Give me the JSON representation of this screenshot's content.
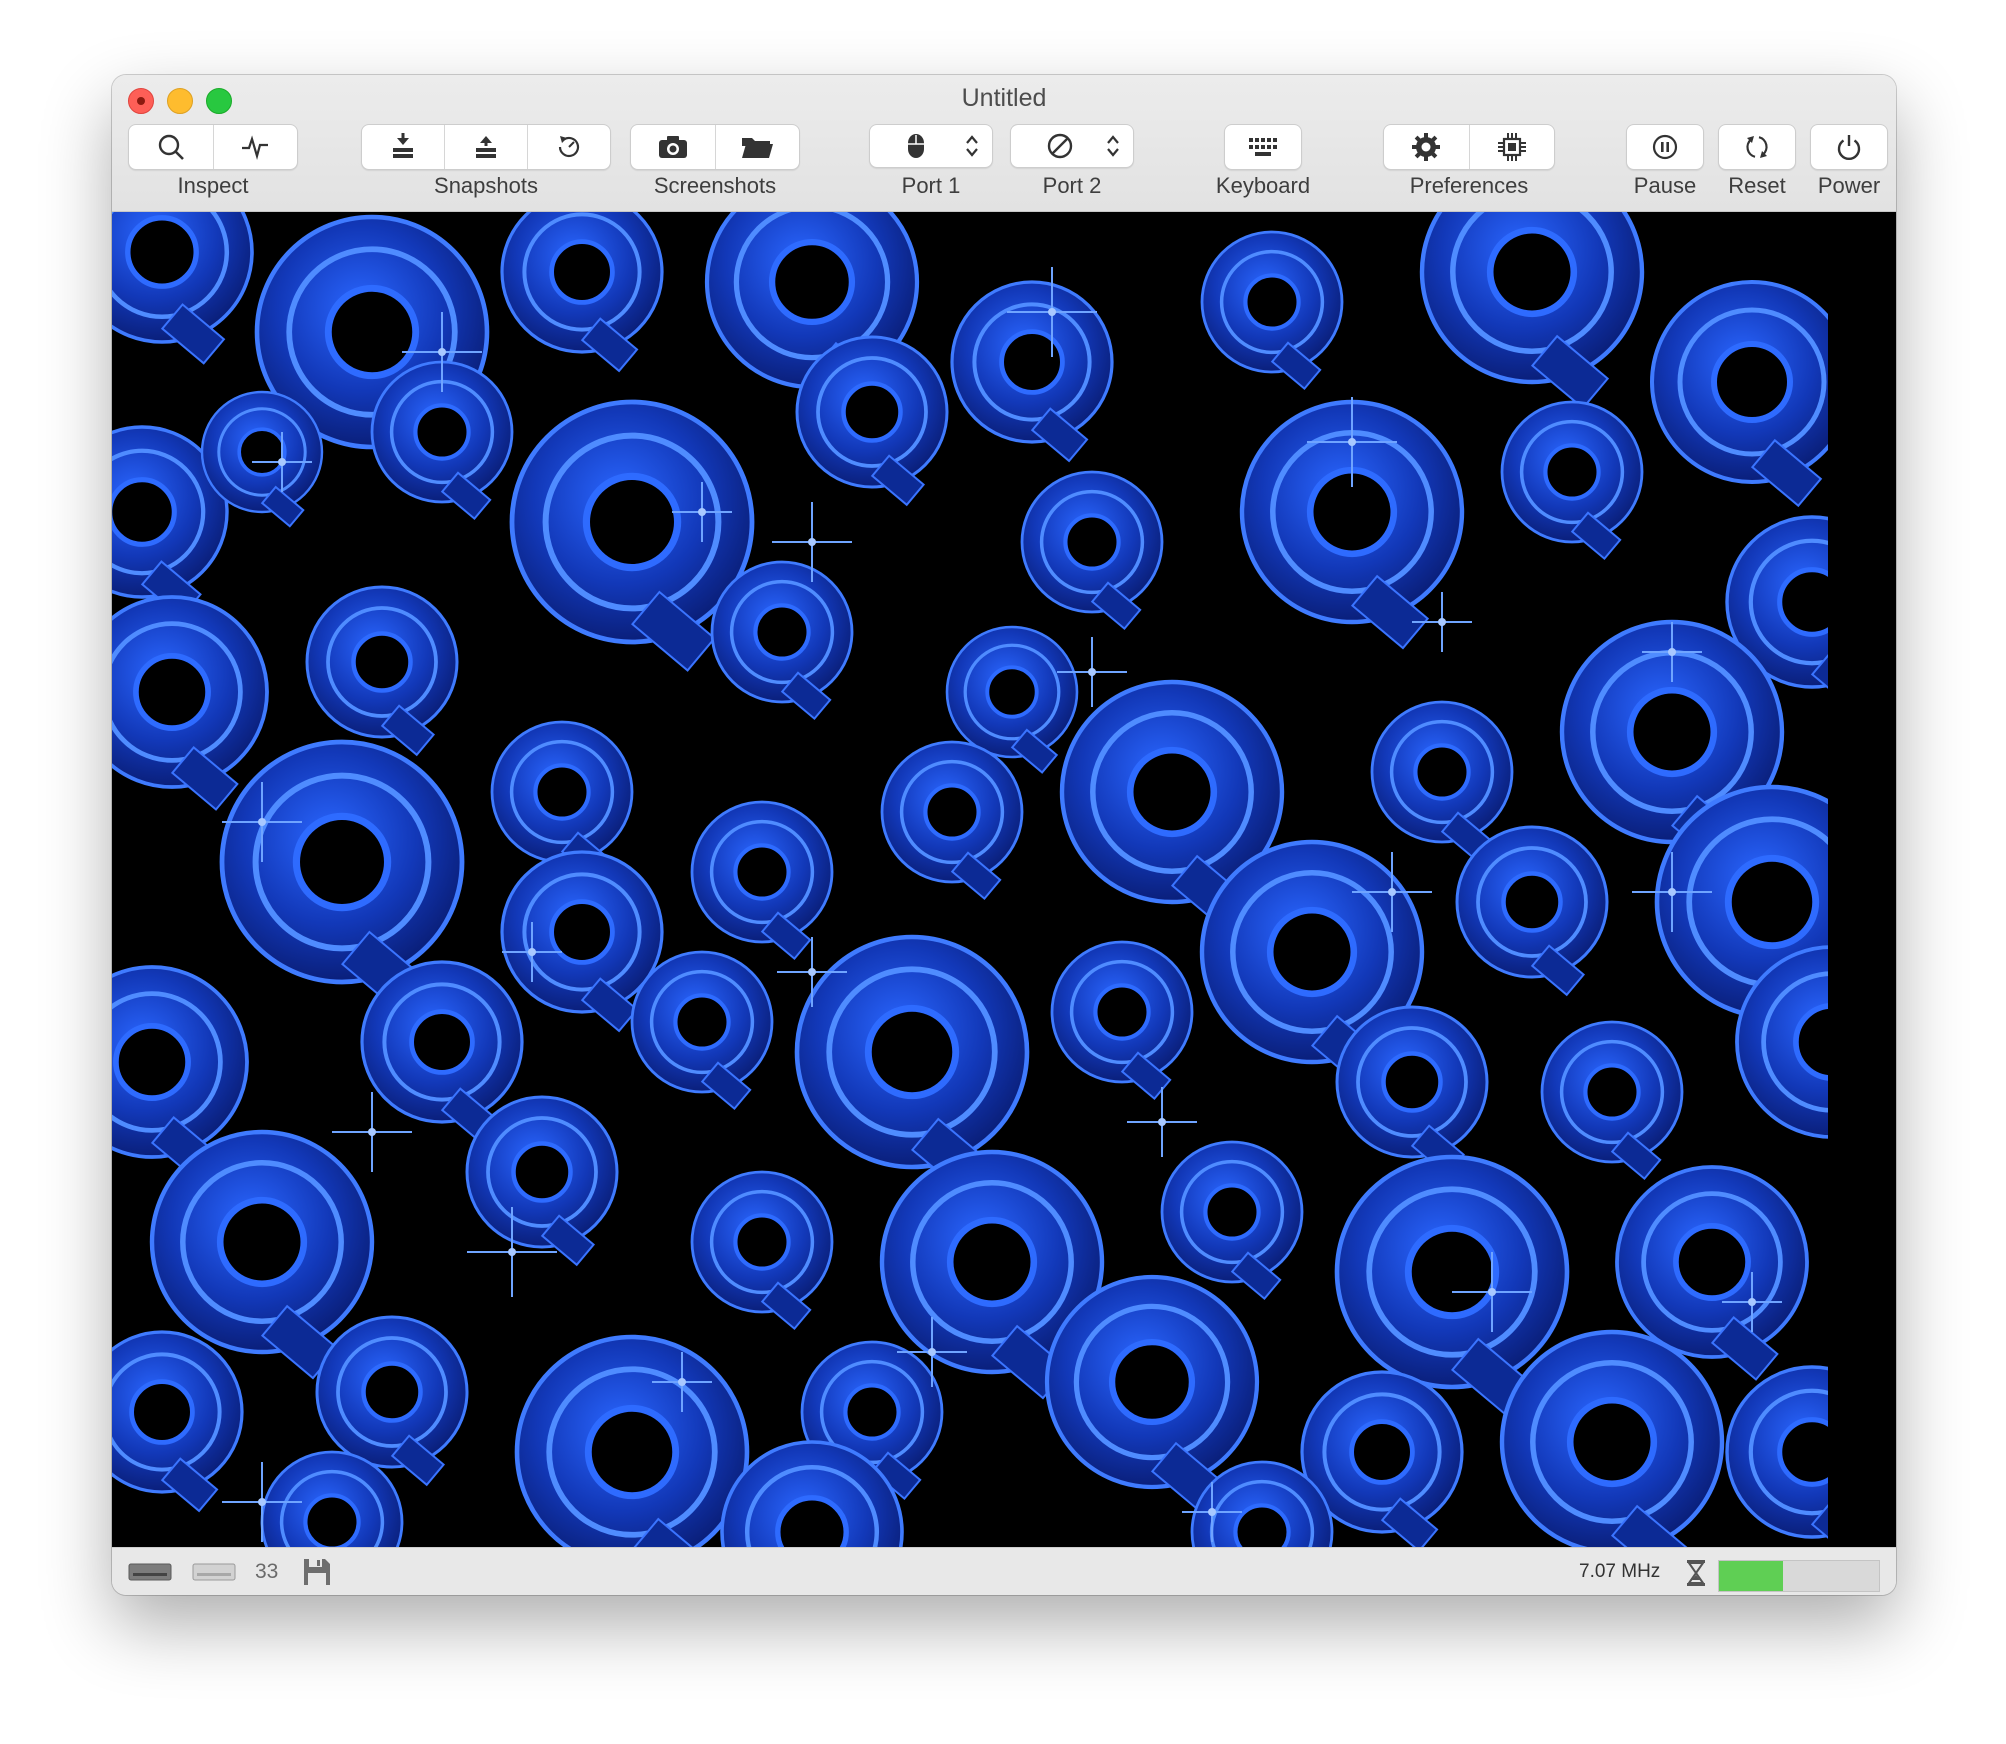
{
  "window": {
    "title": "Untitled"
  },
  "toolbar": {
    "inspect": {
      "label": "Inspect",
      "buttons": [
        "magnifier-icon",
        "activity-icon"
      ]
    },
    "snapshots": {
      "label": "Snapshots",
      "buttons": [
        "snapshot-save-icon",
        "snapshot-restore-icon",
        "snapshot-browse-icon"
      ]
    },
    "screenshots": {
      "label": "Screenshots",
      "buttons": [
        "camera-icon",
        "folder-icon"
      ]
    },
    "port1": {
      "label": "Port 1",
      "device": "mouse-icon"
    },
    "port2": {
      "label": "Port 2",
      "device": "none-icon"
    },
    "keyboard": {
      "label": "Keyboard"
    },
    "preferences": {
      "label": "Preferences",
      "buttons": [
        "gear-icon",
        "chip-icon"
      ]
    },
    "pause": {
      "label": "Pause"
    },
    "reset": {
      "label": "Reset"
    },
    "power": {
      "label": "Power"
    }
  },
  "screen": {
    "background": "#000000",
    "accent": "#1a4fd6"
  },
  "status": {
    "track_number": "33",
    "clock": "7.07 MHz",
    "speed_fraction": 0.4,
    "gauge_color": "#5fcf54"
  }
}
